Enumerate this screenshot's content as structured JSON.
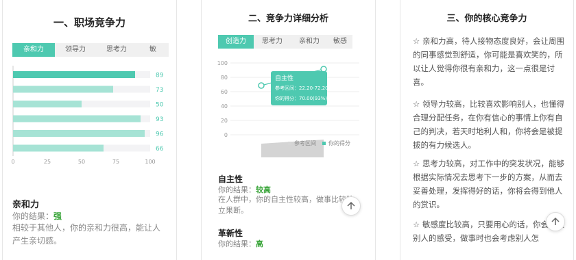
{
  "panel1": {
    "title": "一、职场竞争力",
    "tabs": [
      {
        "label": "亲和力",
        "active": true
      },
      {
        "label": "领导力",
        "active": false
      },
      {
        "label": "思考力",
        "active": false
      },
      {
        "label": "敏",
        "active": false
      }
    ],
    "chart_data": {
      "type": "bar",
      "orientation": "horizontal",
      "categories": [
        "",
        "",
        "",
        "",
        "",
        ""
      ],
      "values": [
        89,
        73,
        50,
        93,
        96,
        66
      ],
      "xlim": [
        0,
        100
      ],
      "xticks": [
        "0",
        "25",
        "50",
        "75",
        "100"
      ],
      "highlight_index": 0,
      "colors": {
        "highlight": "#4ec9b0",
        "normal": "#a6e3d5",
        "track": "#f3f3f5"
      }
    },
    "section": {
      "name": "亲和力",
      "result_label": "你的结果：",
      "result_value": "强",
      "desc_line1": "相较于其他人，你的亲和力很高，能让人",
      "desc_line2": "产生亲切感。"
    }
  },
  "panel2": {
    "title": "二、竞争力详细分析",
    "tabs": [
      {
        "label": "创造力",
        "active": true
      },
      {
        "label": "思考力",
        "active": false
      },
      {
        "label": "亲和力",
        "active": false
      },
      {
        "label": "敏感",
        "active": false
      }
    ],
    "chart_data": {
      "type": "area",
      "yticks": [
        "100",
        "80",
        "60",
        "40",
        "20",
        "0"
      ],
      "ylim": [
        0,
        100
      ],
      "series": [
        {
          "name": "参考区间",
          "color": "#d6d6d6"
        },
        {
          "name": "你的得分",
          "color": "#4ec9b0"
        }
      ],
      "legend": "bottom-right",
      "tooltip": {
        "title": "自主性",
        "range_label": "参考区间：",
        "range_value": "22.20-72.20",
        "score_label": "你的得分：",
        "score_value": "70.00(93%)"
      }
    },
    "sections": [
      {
        "name": "自主性",
        "result_label": "你的结果：",
        "result_value": "较高",
        "desc_line1": "在人群中，你的自主性较高，做事比较独",
        "desc_line2": "立果断。"
      },
      {
        "name": "革新性",
        "result_label": "你的结果：",
        "result_value": "高"
      }
    ]
  },
  "panel3": {
    "title": "三、你的核心竞争力",
    "paragraphs": [
      "☆ 亲和力高，待人接物态度良好，会让周围的同事感觉到舒适，你可能是喜欢笑的，所以让人觉得你很有亲和力，这一点很是讨喜。",
      "☆ 领导力较高，比较喜欢影响别人，也懂得合理分配任务，在你有信心的事情上你有自己的判决，若天时地利人和，你将会是被提拔的有力候选人。",
      "☆ 思考力较高，对工作中的突发状况，能够根据实际情况去思考下一步的方案，从而去妥善处理，发挥得好的话，你将会得到他人的赏识。",
      "☆ 敏感度比较高，只要用心的话，你会照顾别人的感受，做事时也会考虑别人怎"
    ]
  }
}
